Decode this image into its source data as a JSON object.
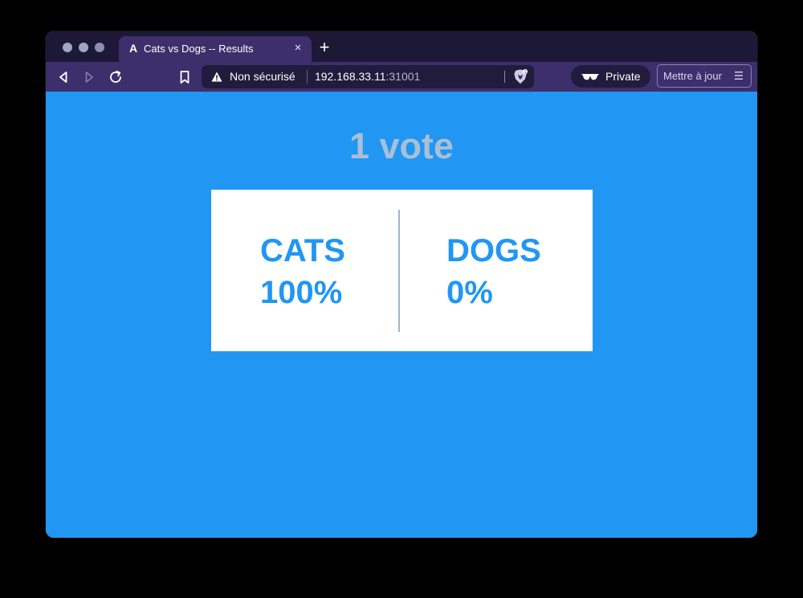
{
  "browser": {
    "tab": {
      "title": "Cats vs Dogs -- Results",
      "favicon": "A"
    },
    "address": {
      "security_text": "Non sécurisé",
      "host": "192.168.33.11",
      "port": ":31001"
    },
    "private_label": "Private",
    "update_label": "Mettre à jour",
    "icons": {
      "new_tab": "plus-icon",
      "close_tab": "close-icon",
      "back": "back-arrow-icon",
      "forward": "forward-arrow-icon",
      "reload": "reload-icon",
      "bookmark": "bookmark-icon",
      "warning": "warning-icon",
      "brave": "brave-shield-icon",
      "private": "private-glasses-icon",
      "menu": "menu-icon"
    },
    "colors": {
      "titlebar": "#1d1835",
      "toolbar": "#3d2f6b",
      "urlbar": "#211b3d"
    }
  },
  "page": {
    "vote_text": "1 vote",
    "choices": [
      {
        "name": "CATS",
        "percent": "100%"
      },
      {
        "name": "DOGS",
        "percent": "0%"
      }
    ],
    "colors": {
      "background": "#2196f3",
      "vote_text": "#a9bfd7",
      "card": "#ffffff",
      "choice_text": "#2196f3"
    }
  }
}
